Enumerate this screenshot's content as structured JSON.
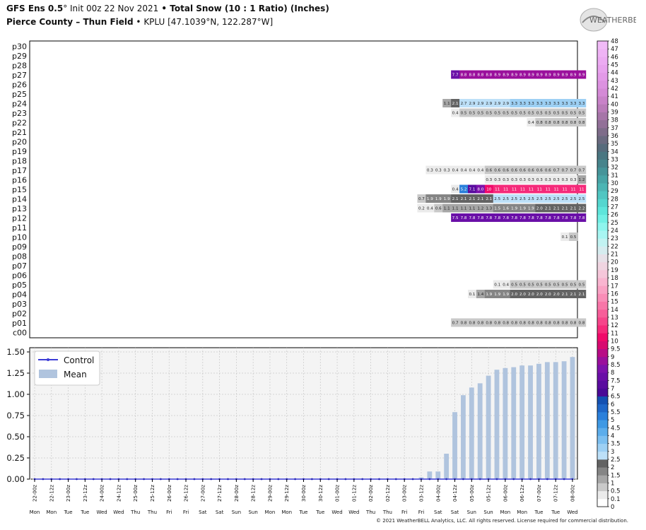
{
  "header": {
    "model": "GFS Ens 0.5",
    "deg": "°",
    "init": " Init 00z 22 Nov 2021",
    "bullet": " • ",
    "title": "Total Snow (10 : 1 Ratio) (Inches)",
    "location": "Pierce County – Thun Field",
    "station": " KPLU [47.1039°N, 122.287°W]"
  },
  "logo": {
    "text": "WEATHERBELL",
    "icon": "weatherbell-logo-icon"
  },
  "copyright": "© 2021 WeatherBELL Analytics, LLC. All rights reserved. License required for commercial distribution.",
  "chart_data": [
    {
      "type": "heatmap",
      "members": [
        "p30",
        "p29",
        "p28",
        "p27",
        "p26",
        "p25",
        "p24",
        "p23",
        "p22",
        "p21",
        "p20",
        "p19",
        "p18",
        "p17",
        "p16",
        "p15",
        "p14",
        "p13",
        "p12",
        "p11",
        "p10",
        "p09",
        "p08",
        "p07",
        "p06",
        "p05",
        "p04",
        "p03",
        "p02",
        "p01",
        "c00"
      ],
      "time_steps": 65,
      "cells": {
        "p27": {
          "start": 50,
          "values": [
            "7.7",
            "8.8",
            "8.8",
            "8.8",
            "8.8",
            "8.9",
            "8.9",
            "8.9",
            "8.9",
            "8.9",
            "8.9",
            "8.9",
            "8.9",
            "8.9",
            "8.9",
            "8.9"
          ]
        },
        "p24": {
          "start": 49,
          "values": [
            "1.1",
            "2.1",
            "2.7",
            "2.9",
            "2.9",
            "2.9",
            "2.9",
            "2.9",
            "3.3",
            "3.3",
            "3.3",
            "3.3",
            "3.3",
            "3.3",
            "3.3",
            "3.3",
            "3.3"
          ]
        },
        "p23": {
          "start": 50,
          "values": [
            "0.4",
            "0.5",
            "0.5",
            "0.5",
            "0.5",
            "0.5",
            "0.5",
            "0.5",
            "0.5",
            "0.5",
            "0.5",
            "0.5",
            "0.5",
            "0.5",
            "0.5",
            "0.5"
          ]
        },
        "p22": {
          "start": 59,
          "values": [
            "0.4",
            "0.8",
            "0.8",
            "0.8",
            "0.8",
            "0.8",
            "0.8"
          ]
        },
        "p17": {
          "start": 47,
          "values": [
            "0.3",
            "0.3",
            "0.3",
            "0.4",
            "0.4",
            "0.4",
            "0.4",
            "0.6",
            "0.6",
            "0.6",
            "0.6",
            "0.6",
            "0.6",
            "0.6",
            "0.6",
            "0.7",
            "0.7",
            "0.7",
            "0.7"
          ]
        },
        "p16": {
          "start": 54,
          "values": [
            "0.3",
            "0.3",
            "0.3",
            "0.3",
            "0.3",
            "0.3",
            "0.3",
            "0.3",
            "0.3",
            "0.3",
            "0.3",
            "1.2"
          ]
        },
        "p15": {
          "start": 50,
          "values": [
            "0.4",
            "5.2",
            "7.1",
            "8.0",
            "10",
            "11",
            "11",
            "11",
            "11",
            "11",
            "11",
            "11",
            "11",
            "11",
            "11",
            "11"
          ]
        },
        "p14": {
          "start": 46,
          "values": [
            "0.7",
            "1.9",
            "1.9",
            "1.9",
            "2.1",
            "2.1",
            "2.1",
            "2.1",
            "2.1",
            "2.5",
            "2.5",
            "2.5",
            "2.5",
            "2.5",
            "2.5",
            "2.5",
            "2.5",
            "2.5",
            "2.5",
            "2.5"
          ]
        },
        "p13": {
          "start": 46,
          "values": [
            "0.2",
            "0.4",
            "0.6",
            "1.1",
            "1.1",
            "1.1",
            "1.1",
            "1.2",
            "1.3",
            "1.5",
            "1.6",
            "1.9",
            "1.9",
            "1.9",
            "2.0",
            "2.1",
            "2.1",
            "2.1",
            "2.1",
            "2.2"
          ]
        },
        "p12": {
          "start": 50,
          "values": [
            "7.5",
            "7.8",
            "7.8",
            "7.8",
            "7.8",
            "7.8",
            "7.8",
            "7.8",
            "7.8",
            "7.8",
            "7.8",
            "7.8",
            "7.8",
            "7.8",
            "7.8",
            "7.8"
          ]
        },
        "p10": {
          "start": 63,
          "values": [
            "0.1",
            "0.5"
          ]
        },
        "p05": {
          "start": 55,
          "values": [
            "0.1",
            "0.4",
            "0.5",
            "0.5",
            "0.5",
            "0.5",
            "0.5",
            "0.5",
            "0.5",
            "0.5",
            "0.5"
          ]
        },
        "p04": {
          "start": 52,
          "values": [
            "0.1",
            "1.4",
            "1.9",
            "1.9",
            "1.9",
            "2.0",
            "2.0",
            "2.0",
            "2.0",
            "2.0",
            "2.0",
            "2.1",
            "2.1",
            "2.1"
          ]
        },
        "p01": {
          "start": 50,
          "values": [
            "0.7",
            "0.8",
            "0.8",
            "0.8",
            "0.8",
            "0.8",
            "0.8",
            "0.8",
            "0.8",
            "0.8",
            "0.8",
            "0.8",
            "0.8",
            "0.8",
            "0.8",
            "0.8"
          ]
        }
      }
    },
    {
      "type": "bar",
      "legend": [
        "Control",
        "Mean"
      ],
      "legend_position": "top-left",
      "grid": true,
      "ylim": [
        0,
        1.5
      ],
      "yticks": [
        "0.00",
        "0.25",
        "0.50",
        "0.75",
        "1.00",
        "1.25",
        "1.50"
      ],
      "x_labels": [
        "22-00z",
        "22-12z",
        "23-00z",
        "23-12z",
        "24-00z",
        "24-12z",
        "25-00z",
        "25-12z",
        "26-00z",
        "26-12z",
        "27-00z",
        "27-12z",
        "28-00z",
        "28-12z",
        "29-00z",
        "29-12z",
        "30-00z",
        "30-12z",
        "01-00z",
        "01-12z",
        "02-00z",
        "02-12z",
        "03-00z",
        "03-12z",
        "04-00z",
        "04-12z",
        "05-00z",
        "05-12z",
        "06-00z",
        "06-12z",
        "07-00z",
        "07-12z",
        "08-00z"
      ],
      "day_labels": [
        "Mon",
        "Mon",
        "Tue",
        "Tue",
        "Wed",
        "Wed",
        "Thu",
        "Thu",
        "Fri",
        "Fri",
        "Sat",
        "Sat",
        "Sun",
        "Sun",
        "Mon",
        "Mon",
        "Tue",
        "Tue",
        "Wed",
        "Wed",
        "Thu",
        "Thu",
        "Fri",
        "Fri",
        "Sat",
        "Sat",
        "Sun",
        "Sun",
        "Mon",
        "Mon",
        "Tue",
        "Tue",
        "Wed"
      ],
      "mean": [
        0,
        0,
        0,
        0,
        0,
        0,
        0,
        0,
        0,
        0,
        0,
        0,
        0,
        0,
        0,
        0,
        0,
        0,
        0,
        0,
        0,
        0,
        0,
        0,
        0,
        0,
        0,
        0,
        0,
        0,
        0,
        0,
        0,
        0,
        0,
        0,
        0,
        0,
        0,
        0,
        0,
        0,
        0,
        0,
        0,
        0,
        0.02,
        0.09,
        0.09,
        0.3,
        0.79,
        0.99,
        1.08,
        1.13,
        1.22,
        1.29,
        1.31,
        1.32,
        1.34,
        1.34,
        1.36,
        1.38,
        1.38,
        1.39,
        1.44
      ],
      "control": [
        0,
        0,
        0,
        0,
        0,
        0,
        0,
        0,
        0,
        0,
        0,
        0,
        0,
        0,
        0,
        0,
        0,
        0,
        0,
        0,
        0,
        0,
        0,
        0,
        0,
        0,
        0,
        0,
        0,
        0,
        0,
        0,
        0,
        0,
        0,
        0,
        0,
        0,
        0,
        0,
        0,
        0,
        0,
        0,
        0,
        0,
        0,
        0,
        0,
        0,
        0,
        0,
        0,
        0,
        0,
        0,
        0,
        0,
        0,
        0,
        0,
        0,
        0,
        0,
        0
      ]
    },
    {
      "type": "colorbar",
      "labels": [
        "0",
        "0.1",
        "0.5",
        "1",
        "1.5",
        "2",
        "2.5",
        "3",
        "3.5",
        "4",
        "4.5",
        "5",
        "5.5",
        "6",
        "6.5",
        "7",
        "7.5",
        "8",
        "8.5",
        "9",
        "9.5",
        "10",
        "11",
        "12",
        "13",
        "14",
        "15",
        "16",
        "17",
        "18",
        "19",
        "20",
        "21",
        "22",
        "23",
        "24",
        "25",
        "26",
        "27",
        "28",
        "29",
        "30",
        "31",
        "32",
        "33",
        "34",
        "35",
        "36",
        "37",
        "38",
        "39",
        "40",
        "41",
        "42",
        "43",
        "44",
        "45",
        "46",
        "47",
        "48"
      ],
      "colors": [
        "#ffffff",
        "#ebebeb",
        "#c9c9c9",
        "#a6a6a6",
        "#858585",
        "#636363",
        "#bde0f8",
        "#9dd0f4",
        "#7cbff0",
        "#5cadeb",
        "#3f99e4",
        "#2b80db",
        "#1f67c8",
        "#1451b2",
        "#4a0a96",
        "#5a0c9f",
        "#6a0fa7",
        "#7d12ac",
        "#9a0f9c",
        "#b80c86",
        "#d80a70",
        "#f00a6a",
        "#f52a7a",
        "#f6458a",
        "#f75e99",
        "#f876a8",
        "#f98db7",
        "#f9a2c4",
        "#f9b5d0",
        "#f6c7da",
        "#f0d5e1",
        "#e7e1e8",
        "#d6ecef",
        "#c2f3f2",
        "#a8f6f2",
        "#8ef5ee",
        "#72efe5",
        "#5ee5db",
        "#55d6cf",
        "#50c6c2",
        "#4cb5b4",
        "#48a4a6",
        "#469499",
        "#47848c",
        "#4a7681",
        "#566b7c",
        "#6a6a80",
        "#7e6c8a",
        "#927098",
        "#a675a8",
        "#b97bb9",
        "#c882c8",
        "#d48ad6",
        "#dc92e0",
        "#e39ae8",
        "#e8a3ee",
        "#ecabf2",
        "#efb3f5",
        "#f1bbf7"
      ]
    }
  ]
}
